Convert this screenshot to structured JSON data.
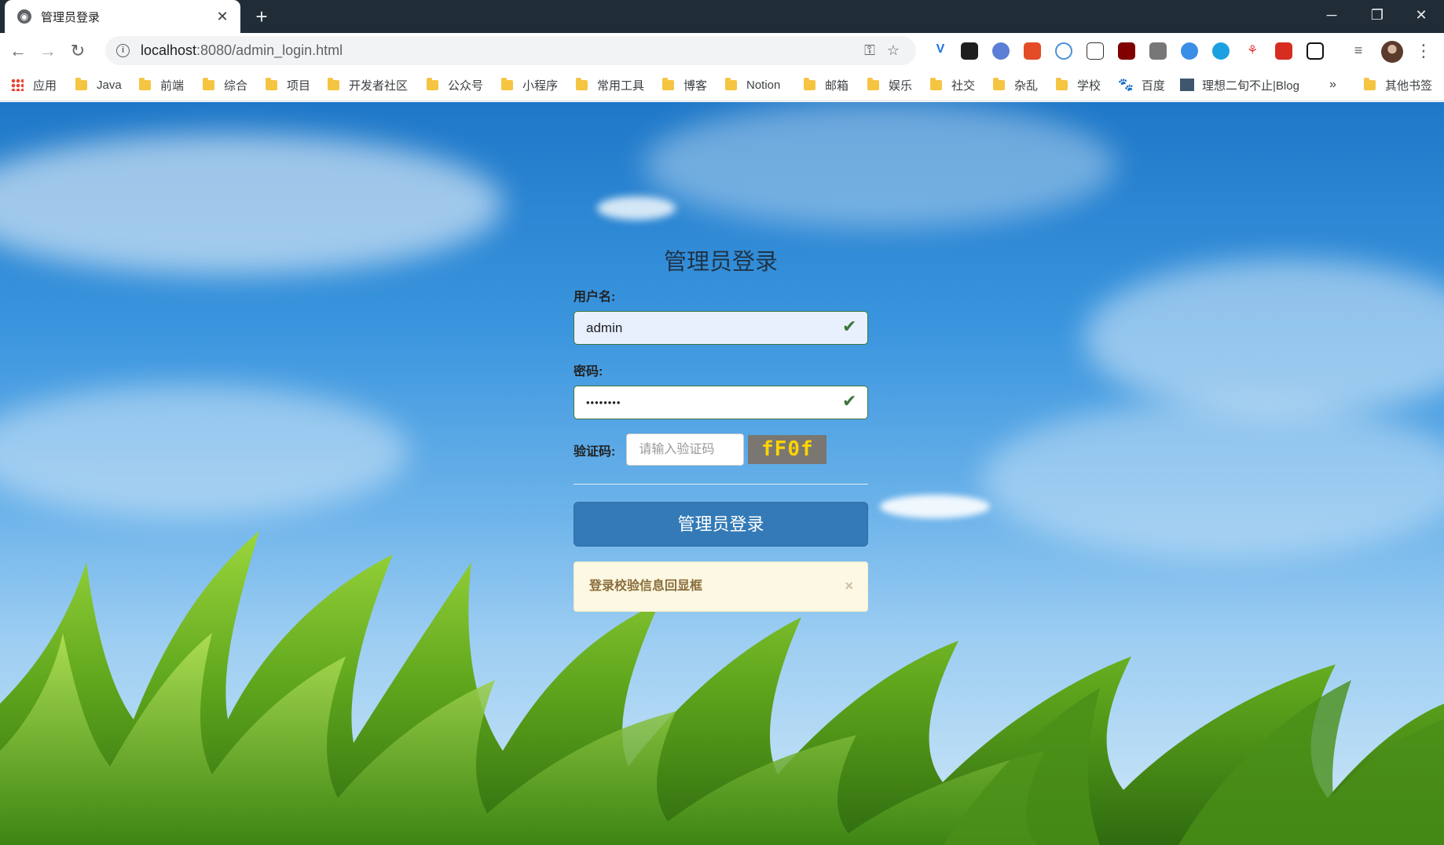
{
  "browser": {
    "tab_title": "管理员登录",
    "tab_close": "✕",
    "new_tab": "+",
    "url_host": "localhost",
    "url_path": ":8080/admin_login.html",
    "window_controls": {
      "minimize": "─",
      "restore": "❐",
      "close": "✕"
    }
  },
  "bookmarks": [
    {
      "label": "应用",
      "icon": "apps-icon"
    },
    {
      "label": "Java",
      "icon": "folder-icon"
    },
    {
      "label": "前端",
      "icon": "folder-icon"
    },
    {
      "label": "综合",
      "icon": "folder-icon"
    },
    {
      "label": "项目",
      "icon": "folder-icon"
    },
    {
      "label": "开发者社区",
      "icon": "folder-icon"
    },
    {
      "label": "公众号",
      "icon": "folder-icon"
    },
    {
      "label": "小程序",
      "icon": "folder-icon"
    },
    {
      "label": "常用工具",
      "icon": "folder-icon"
    },
    {
      "label": "博客",
      "icon": "folder-icon"
    },
    {
      "label": "Notion",
      "icon": "folder-icon"
    },
    {
      "label": "邮箱",
      "icon": "folder-icon"
    },
    {
      "label": "娱乐",
      "icon": "folder-icon"
    },
    {
      "label": "社交",
      "icon": "folder-icon"
    },
    {
      "label": "杂乱",
      "icon": "folder-icon"
    },
    {
      "label": "学校",
      "icon": "folder-icon"
    },
    {
      "label": "百度",
      "icon": "baidu-icon"
    },
    {
      "label": "理想二旬不止|Blog",
      "icon": "blog-icon"
    }
  ],
  "bookmarks_overflow": "»",
  "other_bookmarks": "其他书签",
  "login": {
    "title": "管理员登录",
    "username_label": "用户名:",
    "username_value": "admin",
    "password_label": "密码:",
    "password_value": "••••••••",
    "captcha_label": "验证码:",
    "captcha_placeholder": "请输入验证码",
    "captcha_text": "fF0f",
    "submit_label": "管理员登录",
    "alert_message": "登录校验信息回显框",
    "alert_close": "×"
  },
  "colors": {
    "submit": "#337ab7",
    "alert_bg": "#fcf8e3",
    "valid_check": "#3c763d",
    "captcha_fg": "#ffd400"
  }
}
